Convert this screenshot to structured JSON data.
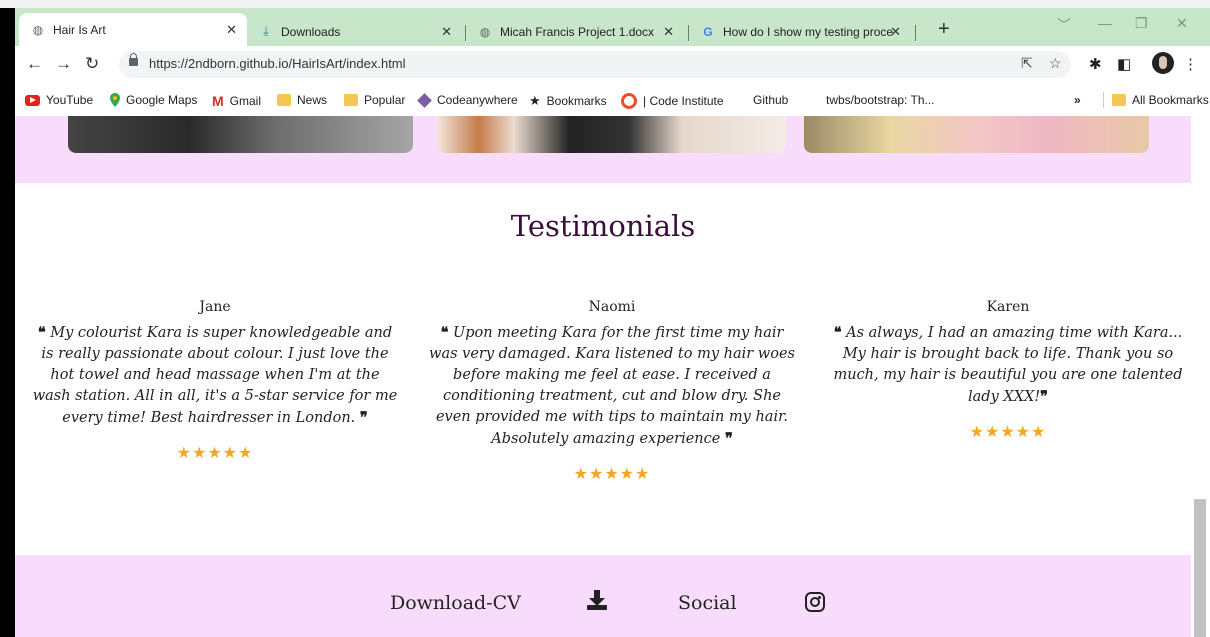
{
  "browser": {
    "tabs": [
      {
        "title": "Hair Is Art",
        "icon": "globe-icon",
        "active": true
      },
      {
        "title": "Downloads",
        "icon": "download-icon",
        "active": false
      },
      {
        "title": "Micah Francis Project 1.docx",
        "icon": "globe-icon",
        "active": false
      },
      {
        "title": "How do I show my testing proce",
        "icon": "google-icon",
        "active": false
      }
    ],
    "url": "https://2ndborn.github.io/HairIsArt/index.html",
    "bookmarks": [
      {
        "label": "YouTube",
        "icon": "youtube-icon"
      },
      {
        "label": "Google Maps",
        "icon": "maps-pin-icon"
      },
      {
        "label": "Gmail",
        "icon": "gmail-icon"
      },
      {
        "label": "News",
        "icon": "folder-icon"
      },
      {
        "label": "Popular",
        "icon": "folder-icon"
      },
      {
        "label": "Codeanywhere",
        "icon": "cube-icon"
      },
      {
        "label": "Bookmarks",
        "icon": "star-icon"
      },
      {
        "label": "| Code Institute",
        "icon": "ring-icon"
      },
      {
        "label": "Github",
        "icon": ""
      },
      {
        "label": "twbs/bootstrap: Th...",
        "icon": ""
      }
    ],
    "bookmarks_overflow": "»",
    "all_bookmarks": "All Bookmarks"
  },
  "page": {
    "testimonials_title": "Testimonials",
    "testimonials": [
      {
        "name": "Jane",
        "quote": "My colourist Kara is super knowledgeable and is really passionate about colour. I just love the hot towel and head massage when I'm at the wash station. All in all, it's a 5-star service for me every time! Best hairdresser in London.",
        "rating": 5
      },
      {
        "name": "Naomi",
        "quote": "Upon meeting Kara for the first time my hair was very damaged. Kara listened to my hair woes before making me feel at ease. I received a conditioning treatment, cut and blow dry. She even provided me with tips to maintain my hair. Absolutely amazing experience",
        "rating": 5
      },
      {
        "name": "Karen",
        "quote": "As always, I had an amazing time with Kara... My hair is brought back to life. Thank you so much, my hair is beautiful you are one talented lady XXX!",
        "rating": 5
      }
    ],
    "open_quote": "❝",
    "close_quote": "❞",
    "stars": "★★★★★",
    "footer": {
      "download_label": "Download-CV",
      "social_label": "Social"
    }
  },
  "colors": {
    "accent_pink": "#f7dcfb",
    "heading_purple": "#3a0f3e",
    "star_orange": "#f5a623",
    "chrome_green": "#c8e6c9"
  }
}
